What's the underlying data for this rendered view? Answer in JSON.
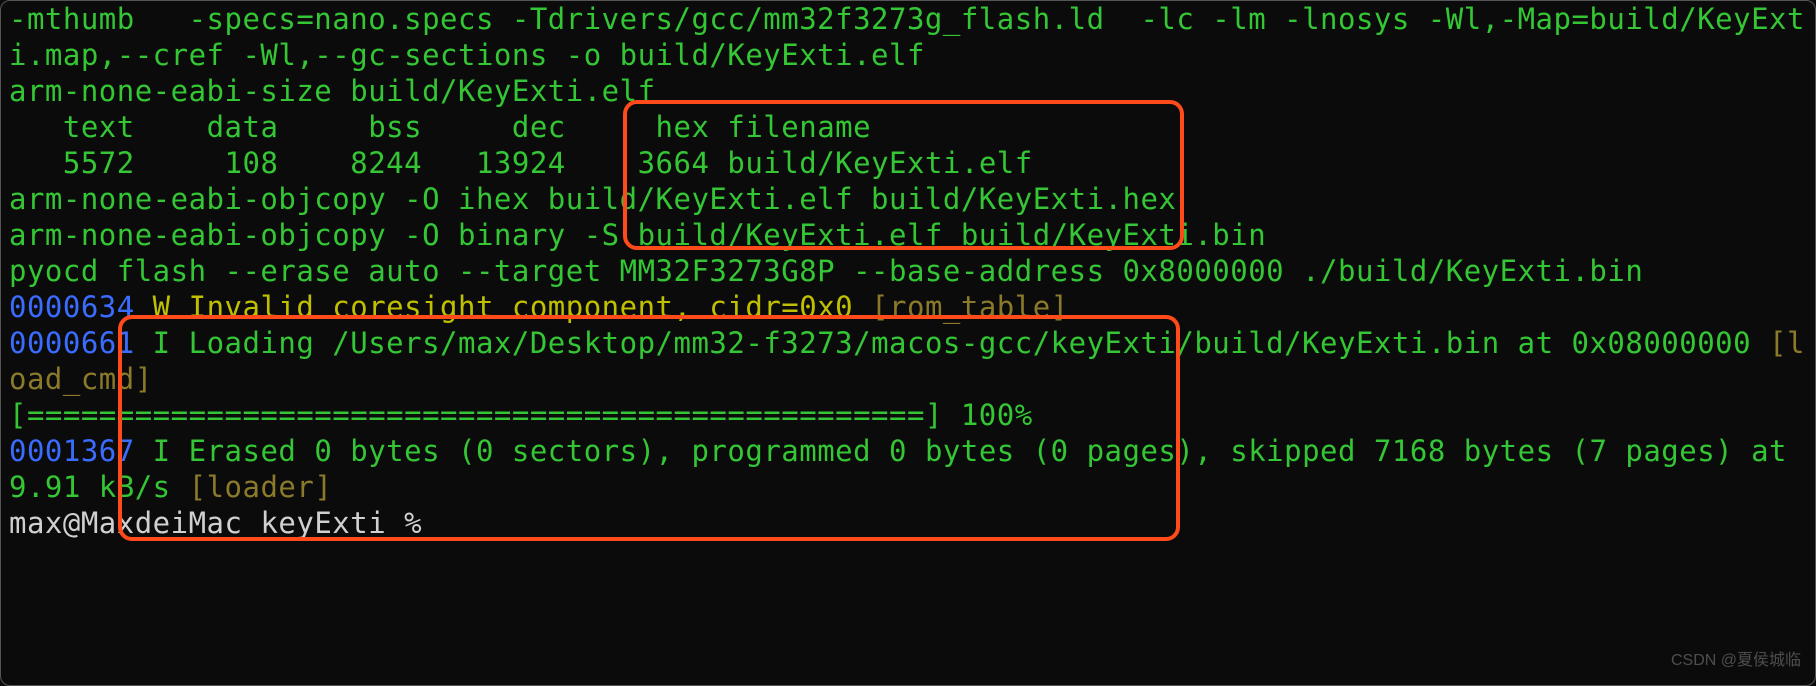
{
  "lines": {
    "l1": "-mthumb   -specs=nano.specs -Tdrivers/gcc/mm32f3273g_flash.ld  -lc -lm -lnosys -Wl,-Map=build/KeyExti.map,--cref -Wl,--gc-sections -o build/KeyExti.elf",
    "l2": "arm-none-eabi-size build/KeyExti.elf",
    "l3": "   text    data     bss     dec     hex filename",
    "l4": "   5572     108    8244   13924    3664 build/KeyExti.elf",
    "l5": "arm-none-eabi-objcopy -O ihex build/KeyExti.elf build/KeyExti.hex",
    "l6": "arm-none-eabi-objcopy -O binary -S build/KeyExti.elf build/KeyExti.bin",
    "l7": "pyocd flash --erase auto --target MM32F3273G8P --base-address 0x8000000 ./build/KeyExti.bin",
    "ts8": "0000634",
    "lvl8": " W ",
    "msg8": "Invalid coresight component, cidr=0x0 ",
    "tag8": "[rom_table]",
    "ts9": "0000661",
    "lvl9": " I ",
    "msg9": "Loading /Users/max/Desktop/mm32-f3273/macos-gcc/keyExti/build/KeyExti.bin at 0x08000000 ",
    "tag9": "[load_cmd]",
    "prog": "[==================================================] 100%",
    "ts10": "0001367",
    "lvl10": " I ",
    "msg10": "Erased 0 bytes (0 sectors), programmed 0 bytes (0 pages), skipped 7168 bytes (7 pages) at 9.91 kB/s ",
    "tag10": "[loader]",
    "prompt_host": "max@MaxdeiMac ",
    "prompt_dir": "keyExti",
    "prompt_sym": " % "
  },
  "watermark": "CSDN @夏侯城临",
  "colors": {
    "bg": "#0b0b0b",
    "fg_green": "#34c634",
    "fg_yellow": "#c0c000",
    "fg_blue": "#3a6cff",
    "fg_olive": "#8a7a2a",
    "annotation": "#ff4a1a"
  }
}
